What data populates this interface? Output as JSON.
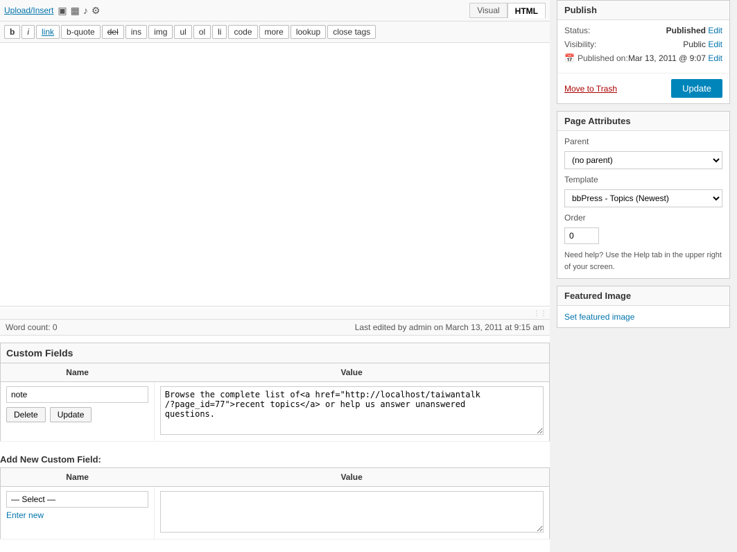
{
  "toolbar": {
    "upload_insert": "Upload/Insert",
    "view_visual": "Visual",
    "view_html": "HTML"
  },
  "toolbar_icons": {
    "icon1": "▣",
    "icon2": "▦",
    "icon3": "♪",
    "icon4": "⚙"
  },
  "format_buttons": [
    {
      "id": "b",
      "label": "b",
      "style": "bold"
    },
    {
      "id": "i",
      "label": "i",
      "style": "italic"
    },
    {
      "id": "link",
      "label": "link",
      "style": "link"
    },
    {
      "id": "b-quote",
      "label": "b-quote",
      "style": ""
    },
    {
      "id": "del",
      "label": "del",
      "style": "del"
    },
    {
      "id": "ins",
      "label": "ins",
      "style": ""
    },
    {
      "id": "img",
      "label": "img",
      "style": ""
    },
    {
      "id": "ul",
      "label": "ul",
      "style": ""
    },
    {
      "id": "ol",
      "label": "ol",
      "style": ""
    },
    {
      "id": "li",
      "label": "li",
      "style": ""
    },
    {
      "id": "code",
      "label": "code",
      "style": ""
    },
    {
      "id": "more",
      "label": "more",
      "style": ""
    },
    {
      "id": "lookup",
      "label": "lookup",
      "style": ""
    },
    {
      "id": "close_tags",
      "label": "close tags",
      "style": ""
    }
  ],
  "editor": {
    "content": "",
    "word_count_label": "Word count:",
    "word_count": "0",
    "last_edited": "Last edited by admin on March 13, 2011 at 9:15 am",
    "resize_char": "⋮"
  },
  "custom_fields": {
    "section_title": "Custom Fields",
    "name_col": "Name",
    "value_col": "Value",
    "existing_name": "note",
    "existing_value": "Browse the complete list of<a href=\"http://localhost/taiwantalk/?page_id=77\">recent topics</a> or help us answer unanswered questions.",
    "delete_btn": "Delete",
    "update_btn": "Update",
    "add_new_title": "Add New Custom Field:",
    "select_placeholder": "— Select —",
    "enter_new": "Enter new"
  },
  "sidebar": {
    "publish_panel": {
      "title": "Publish",
      "status_label": "Status:",
      "status_value": "Published",
      "status_edit": "Edit",
      "visibility_label": "Visibility:",
      "visibility_value": "Public",
      "visibility_edit": "Edit",
      "published_label": "Published on:",
      "published_value": "Mar 13, 2011 @ 9:07",
      "published_edit": "Edit",
      "move_trash": "Move to Trash",
      "update_btn": "Update"
    },
    "page_attributes": {
      "title": "Page Attributes",
      "parent_label": "Parent",
      "parent_value": "(no parent)",
      "template_label": "Template",
      "template_value": "bbPress - Topics (Newest)",
      "order_label": "Order",
      "order_value": "0",
      "help_text": "Need help? Use the Help tab in the upper right of your screen."
    },
    "featured_image": {
      "title": "Featured Image",
      "set_link": "Set featured image"
    }
  }
}
